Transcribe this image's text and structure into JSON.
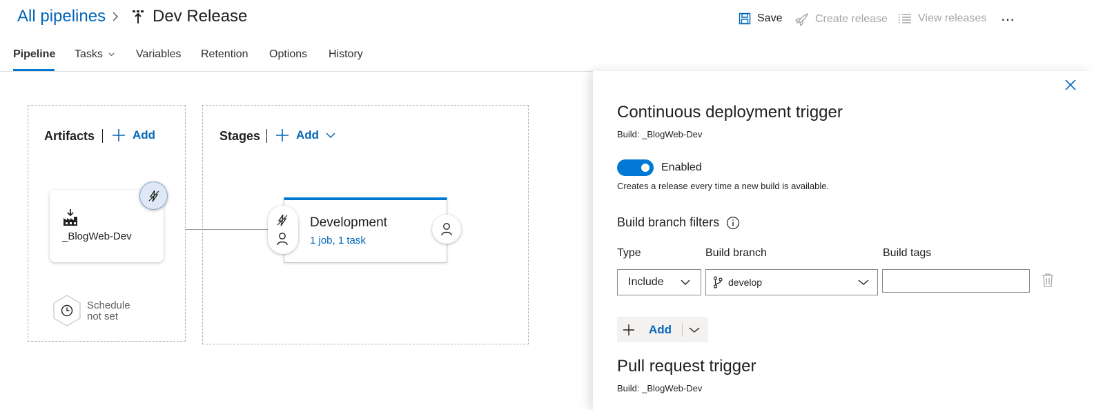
{
  "header": {
    "breadcrumb_root": "All pipelines",
    "breadcrumb_sep_icon": "chevron-right-icon",
    "pipeline_title": "Dev Release"
  },
  "toolbar": {
    "save_label": "Save",
    "create_release_label": "Create release",
    "view_releases_label": "View releases",
    "more_label": "⋯"
  },
  "tabs": [
    {
      "label": "Pipeline",
      "active": true
    },
    {
      "label": "Tasks"
    },
    {
      "label": "Variables"
    },
    {
      "label": "Retention"
    },
    {
      "label": "Options"
    },
    {
      "label": "History"
    }
  ],
  "artifacts": {
    "title": "Artifacts",
    "add_label": "Add",
    "artifact_name": "_BlogWeb-Dev",
    "schedule_line1": "Schedule",
    "schedule_line2": "not set"
  },
  "stages": {
    "title": "Stages",
    "add_label": "Add",
    "stage_name": "Development",
    "stage_summary": "1 job, 1 task"
  },
  "panel": {
    "cd_title": "Continuous deployment trigger",
    "cd_build": "Build: _BlogWeb-Dev",
    "toggle_state": "Enabled",
    "toggle_on": true,
    "cd_description": "Creates a release every time a new build is available.",
    "filters_title": "Build branch filters",
    "col_type": "Type",
    "col_branch": "Build branch",
    "col_tags": "Build tags",
    "type_value": "Include",
    "branch_value": "develop",
    "tags_value": "",
    "add_label": "Add",
    "pr_title": "Pull request trigger",
    "pr_build": "Build: _BlogWeb-Dev"
  },
  "colors": {
    "accent": "#0078d4",
    "link": "#0366b8",
    "disabled": "#a6a6a6"
  }
}
